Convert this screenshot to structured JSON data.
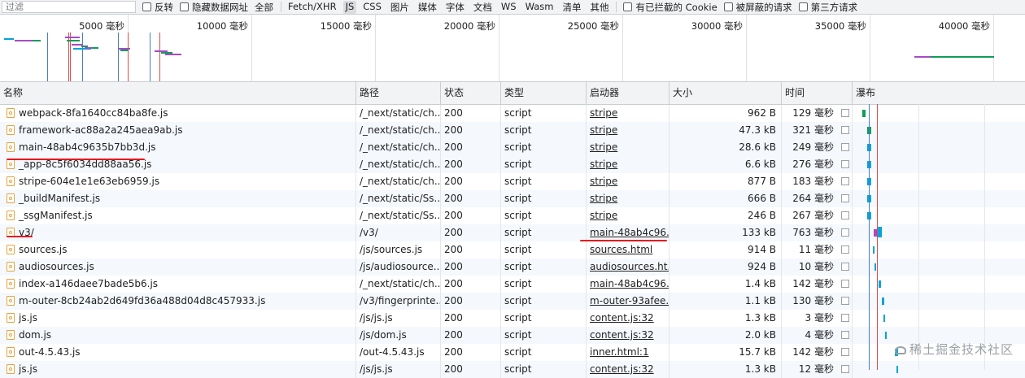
{
  "filter": {
    "placeholder": "过滤",
    "invert_label": "反转",
    "hide_data_urls_label": "隐藏数据网址",
    "all_label": "全部",
    "types": [
      "Fetch/XHR",
      "JS",
      "CSS",
      "图片",
      "媒体",
      "字体",
      "文档",
      "WS",
      "Wasm",
      "清单",
      "其他"
    ],
    "active_type": "JS",
    "blocked_cookies_label": "有已拦截的 Cookie",
    "blocked_requests_label": "被屏蔽的请求",
    "third_party_label": "第三方请求"
  },
  "overview": {
    "ticks": [
      "5000 毫秒",
      "10000 毫秒",
      "15000 毫秒",
      "20000 毫秒",
      "25000 毫秒",
      "30000 毫秒",
      "35000 毫秒",
      "40000 毫秒"
    ]
  },
  "columns": {
    "name": "名称",
    "path": "路径",
    "status": "状态",
    "type": "类型",
    "initiator": "启动器",
    "size": "大小",
    "time": "时间",
    "waterfall": "瀑布"
  },
  "rows": [
    {
      "name": "webpack-8fa1640cc84ba8fe.js",
      "path": "/_next/static/ch...",
      "status": "200",
      "type": "script",
      "initiator": "stripe",
      "size": "962 B",
      "time": "129 毫秒"
    },
    {
      "name": "framework-ac88a2a245aea9ab.js",
      "path": "/_next/static/ch...",
      "status": "200",
      "type": "script",
      "initiator": "stripe",
      "size": "47.3 kB",
      "time": "321 毫秒"
    },
    {
      "name": "main-48ab4c9635b7bb3d.js",
      "path": "/_next/static/ch...",
      "status": "200",
      "type": "script",
      "initiator": "stripe",
      "size": "28.6 kB",
      "time": "249 毫秒"
    },
    {
      "name": "_app-8c5f6034dd88aa56.js",
      "path": "/_next/static/ch...",
      "status": "200",
      "type": "script",
      "initiator": "stripe",
      "size": "6.6 kB",
      "time": "276 毫秒"
    },
    {
      "name": "stripe-604e1e1e63eb6959.js",
      "path": "/_next/static/ch...",
      "status": "200",
      "type": "script",
      "initiator": "stripe",
      "size": "877 B",
      "time": "183 毫秒"
    },
    {
      "name": "_buildManifest.js",
      "path": "/_next/static/Ss...",
      "status": "200",
      "type": "script",
      "initiator": "stripe",
      "size": "666 B",
      "time": "264 毫秒"
    },
    {
      "name": "_ssgManifest.js",
      "path": "/_next/static/Ss...",
      "status": "200",
      "type": "script",
      "initiator": "stripe",
      "size": "246 B",
      "time": "267 毫秒"
    },
    {
      "name": "v3/",
      "path": "/v3/",
      "status": "200",
      "type": "script",
      "initiator": "main-48ab4c96...",
      "size": "133 kB",
      "time": "763 毫秒"
    },
    {
      "name": "sources.js",
      "path": "/js/sources.js",
      "status": "200",
      "type": "script",
      "initiator": "sources.html",
      "size": "914 B",
      "time": "11 毫秒"
    },
    {
      "name": "audiosources.js",
      "path": "/js/audiosource...",
      "status": "200",
      "type": "script",
      "initiator": "audiosources.ht...",
      "size": "924 B",
      "time": "10 毫秒"
    },
    {
      "name": "index-a146daee7bade5b6.js",
      "path": "/_next/static/ch...",
      "status": "200",
      "type": "script",
      "initiator": "main-48ab4c96...",
      "size": "1.4 kB",
      "time": "142 毫秒"
    },
    {
      "name": "m-outer-8cb24ab2d649fd36a488d04d8c457933.js",
      "path": "/v3/fingerprinte...",
      "status": "200",
      "type": "script",
      "initiator": "m-outer-93afee...",
      "size": "1.1 kB",
      "time": "130 毫秒"
    },
    {
      "name": "js.js",
      "path": "/js/js.js",
      "status": "200",
      "type": "script",
      "initiator": "content.js:32",
      "size": "1.3 kB",
      "time": "3 毫秒"
    },
    {
      "name": "dom.js",
      "path": "/js/dom.js",
      "status": "200",
      "type": "script",
      "initiator": "content.js:32",
      "size": "2.0 kB",
      "time": "4 毫秒"
    },
    {
      "name": "out-4.5.43.js",
      "path": "/out-4.5.43.js",
      "status": "200",
      "type": "script",
      "initiator": "inner.html:1",
      "size": "15.7 kB",
      "time": "142 毫秒"
    },
    {
      "name": "js.js",
      "path": "/js/js.js",
      "status": "200",
      "type": "script",
      "initiator": "content.js:32",
      "size": "1.3 kB",
      "time": "12 毫秒"
    }
  ],
  "watermark": "稀土掘金技术社区",
  "colors": {
    "waiting": "#00a4d6",
    "queued": "#c0c0c0",
    "connect": "#a64ac9",
    "download": "#0f9d58",
    "annotation": "#e8171d"
  }
}
